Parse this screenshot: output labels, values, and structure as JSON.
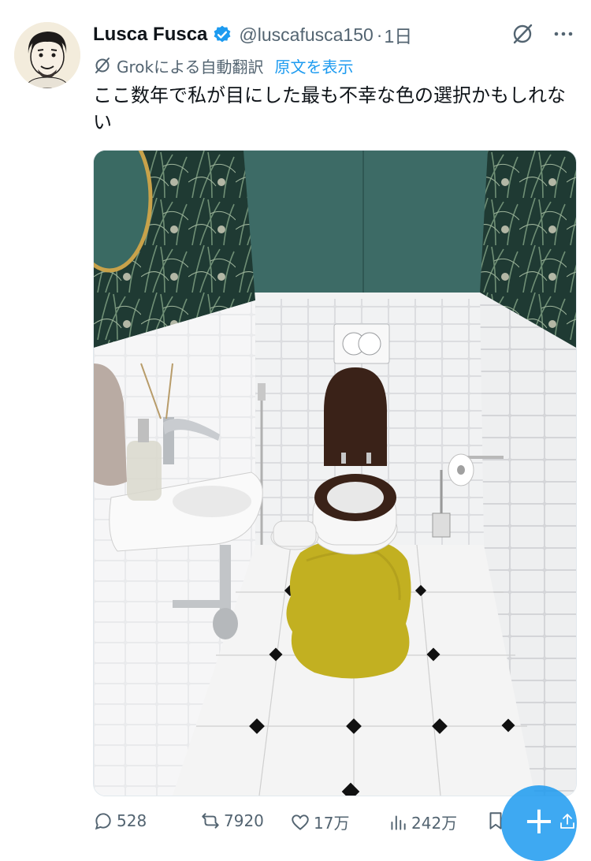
{
  "tweet": {
    "author_name": "Lusca Fusca",
    "handle": "@luscafusca150",
    "separator": "·",
    "time": "1日",
    "translation_label": "Grokによる自動翻訳",
    "show_original": "原文を表示",
    "text": "ここ数年で私が目にした最も不幸な色の選択かもしれない"
  },
  "actions": {
    "replies": "528",
    "reposts": "7920",
    "likes": "17万",
    "views": "242万"
  },
  "colors": {
    "accent": "#1d9bf0",
    "verified": "#1d9bf0",
    "secondary_text": "#536471",
    "rug": "#c2b021",
    "toilet_seat": "#3a2218",
    "wall_green": "#3d6b66"
  },
  "icons": {
    "verified": "verified-badge-icon",
    "grok": "grok-off-icon",
    "more": "more-horizontal-icon",
    "translate": "translate-icon",
    "reply": "reply-icon",
    "repost": "repost-icon",
    "like": "heart-icon",
    "views": "views-icon",
    "bookmark": "bookmark-icon",
    "share": "share-icon",
    "compose": "compose-plus-icon"
  }
}
